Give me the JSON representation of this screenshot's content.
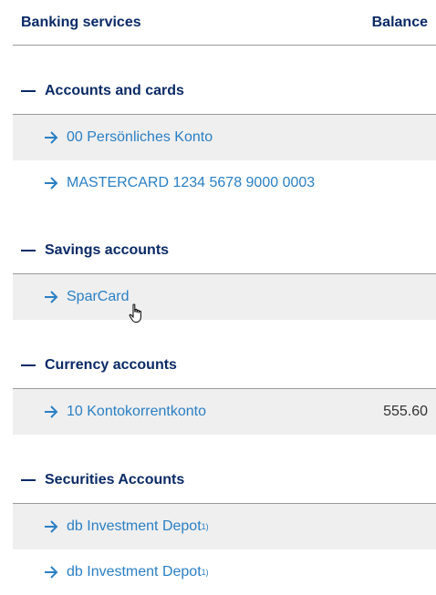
{
  "header": {
    "left": "Banking services",
    "right": "Balance"
  },
  "groups": [
    {
      "title": "Accounts and cards",
      "items": [
        {
          "label": "00 Persönliches Konto",
          "amount": "",
          "sup": ""
        },
        {
          "label": "MASTERCARD 1234 5678 9000 0003",
          "amount": "",
          "sup": ""
        }
      ]
    },
    {
      "title": "Savings accounts",
      "items": [
        {
          "label": "SparCard",
          "amount": "",
          "sup": ""
        }
      ]
    },
    {
      "title": "Currency accounts",
      "items": [
        {
          "label": "10 Kontokorrentkonto",
          "amount": "555.60",
          "sup": ""
        }
      ]
    },
    {
      "title": "Securities Accounts",
      "items": [
        {
          "label": "db Investment Depot",
          "amount": "",
          "sup": "1)"
        },
        {
          "label": "db Investment Depot",
          "amount": "",
          "sup": "1)"
        }
      ]
    }
  ],
  "colors": {
    "heading": "#0a2a66",
    "link": "#2a7fc4",
    "row_shade": "#efefef",
    "divider": "#9a9a9a"
  },
  "icons": {
    "expand": "minus-icon",
    "link": "arrow-right-icon",
    "cursor": "hand-pointer-icon"
  }
}
